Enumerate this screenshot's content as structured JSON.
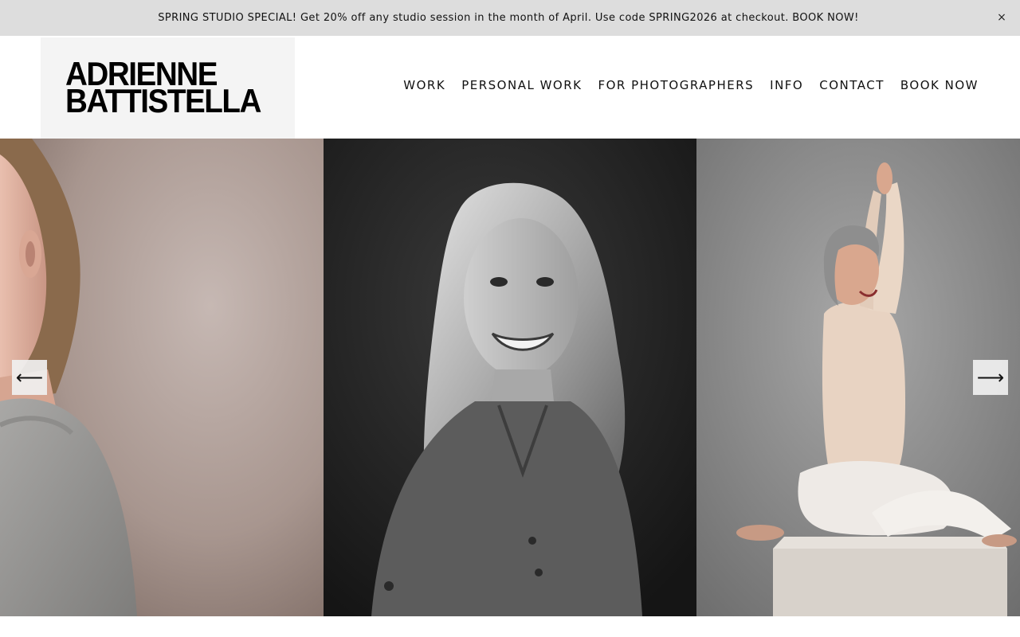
{
  "announcement": {
    "text": "SPRING STUDIO SPECIAL! Get 20% off any studio session in the month of April. Use code SPRING2026 at checkout. BOOK NOW!",
    "close_glyph": "×"
  },
  "logo": {
    "line1": "ADRIENNE",
    "line2": "BATTISTELLA"
  },
  "nav": {
    "items": [
      {
        "label": "WORK"
      },
      {
        "label": "PERSONAL WORK"
      },
      {
        "label": "FOR PHOTOGRAPHERS"
      },
      {
        "label": "INFO"
      },
      {
        "label": "CONTACT"
      },
      {
        "label": "BOOK NOW"
      }
    ]
  },
  "gallery": {
    "prev_glyph": "⟵",
    "next_glyph": "⟶",
    "slides": [
      {
        "subject": "woman-grey-sweater-portrait",
        "tone": "color"
      },
      {
        "subject": "smiling-woman-black-and-white-portrait",
        "tone": "black-and-white"
      },
      {
        "subject": "woman-yoga-pose-on-box-portrait",
        "tone": "color"
      }
    ]
  },
  "colors": {
    "announcement_bg": "#dddddd",
    "logo_bg": "#f4f4f4",
    "text": "#111111"
  }
}
